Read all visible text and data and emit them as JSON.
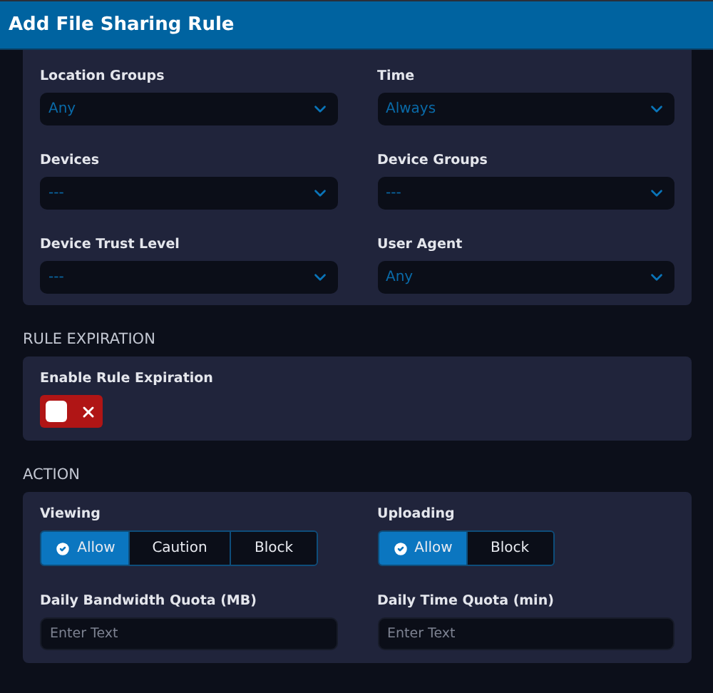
{
  "title": "Add File Sharing Rule",
  "sections": [
    {
      "fields": [
        {
          "kind": "select",
          "label": "Location Groups",
          "value": "Any"
        },
        {
          "kind": "select",
          "label": "Time",
          "value": "Always"
        },
        {
          "kind": "select",
          "label": "Devices",
          "value": "---"
        },
        {
          "kind": "select",
          "label": "Device Groups",
          "value": "---"
        },
        {
          "kind": "select",
          "label": "Device Trust Level",
          "value": "---"
        },
        {
          "kind": "select",
          "label": "User Agent",
          "value": "Any"
        }
      ]
    },
    {
      "heading": "RULE EXPIRATION",
      "fields": [
        {
          "kind": "toggle",
          "label": "Enable Rule Expiration",
          "on": false
        }
      ]
    },
    {
      "heading": "ACTION",
      "fields": [
        {
          "kind": "segmented",
          "label": "Viewing",
          "options": [
            {
              "label": "Allow",
              "selected": true
            },
            {
              "label": "Caution",
              "selected": false
            },
            {
              "label": "Block",
              "selected": false
            }
          ]
        },
        {
          "kind": "segmented",
          "label": "Uploading",
          "options": [
            {
              "label": "Allow",
              "selected": true
            },
            {
              "label": "Block",
              "selected": false
            }
          ]
        },
        {
          "kind": "text",
          "label": "Daily Bandwidth Quota (MB)",
          "placeholder": "Enter Text"
        },
        {
          "kind": "text",
          "label": "Daily Time Quota (min)",
          "placeholder": "Enter Text"
        }
      ]
    }
  ]
}
